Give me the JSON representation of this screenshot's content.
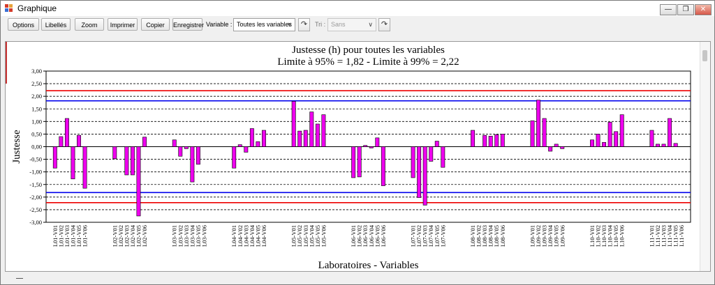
{
  "window": {
    "title": "Graphique",
    "minimize_icon": "minimize-icon",
    "restore_icon": "restore-icon",
    "close_icon": "close-icon"
  },
  "toolbar": {
    "options_label": "Options",
    "labels_label": "Libellés",
    "zoom_label": "Zoom",
    "print_label": "Imprimer",
    "copy_label": "Copier",
    "save_label": "Enregistrer",
    "variable_label": "Variable :",
    "variable_value": "Toutes les variables",
    "sort_label": "Tri :",
    "sort_value": "Sans"
  },
  "chart_data": {
    "type": "bar",
    "title": "Justesse (h) pour toutes les variables",
    "subtitle": "Limite à 95% = 1,82 - Limite à 99% = 2,22",
    "xlabel": "Laboratoires - Variables",
    "ylabel": "Justesse",
    "ylim": [
      -3,
      3
    ],
    "ytick_labels": [
      "3,00",
      "2,50",
      "2,00",
      "1,50",
      "1,00",
      "0,50",
      "0,00",
      "-0,50",
      "-1,00",
      "-1,50",
      "-2,00",
      "-2,50",
      "-3,00"
    ],
    "grid": "horizontal dashed",
    "bar_color": "#ee00ee",
    "limit_lines": [
      {
        "value": 2.22,
        "color": "#ee0000"
      },
      {
        "value": 1.82,
        "color": "#0000ee"
      },
      {
        "value": -1.82,
        "color": "#0000ee"
      },
      {
        "value": -2.22,
        "color": "#ee0000"
      }
    ],
    "groups": [
      {
        "categories": [
          "L01-V01",
          "L01-V02",
          "L01-V03",
          "L01-V04",
          "L01-V05",
          "L01-V06"
        ],
        "values": [
          -0.85,
          0.4,
          1.12,
          -1.28,
          0.45,
          -1.65
        ]
      },
      {
        "categories": [
          "L02-V01",
          "L02-V02",
          "L02-V03",
          "L02-V04",
          "L02-V05",
          "L02-V06"
        ],
        "values": [
          -0.48,
          0.0,
          -1.12,
          -1.12,
          -2.75,
          0.38
        ]
      },
      {
        "categories": [
          "L03-V01",
          "L03-V02",
          "L03-V03",
          "L03-V04",
          "L03-V05",
          "L03-V06"
        ],
        "values": [
          0.27,
          -0.38,
          -0.08,
          -1.4,
          -0.7,
          0.0
        ]
      },
      {
        "categories": [
          "L04-V01",
          "L04-V02",
          "L04-V03",
          "L04-V04",
          "L04-V05",
          "L04-V06"
        ],
        "values": [
          -0.85,
          0.08,
          -0.22,
          0.72,
          0.2,
          0.65
        ]
      },
      {
        "categories": [
          "L05-V01",
          "L05-V02",
          "L05-V03",
          "L05-V04",
          "L05-V05",
          "L05-V06"
        ],
        "values": [
          1.8,
          0.62,
          0.65,
          1.38,
          0.9,
          1.27
        ]
      },
      {
        "categories": [
          "L06-V01",
          "L06-V02",
          "L06-V03",
          "L06-V04",
          "L06-V05",
          "L06-V06"
        ],
        "values": [
          -1.23,
          -1.2,
          0.05,
          -0.05,
          0.35,
          -1.55
        ]
      },
      {
        "categories": [
          "L07-V01",
          "L07-V02",
          "L07-V03",
          "L07-V04",
          "L07-V05",
          "L07-V06"
        ],
        "values": [
          -1.23,
          -2.02,
          -2.32,
          -0.58,
          0.22,
          -0.82
        ]
      },
      {
        "categories": [
          "L08-V01",
          "L08-V02",
          "L08-V03",
          "L08-V04",
          "L08-V05",
          "L08-V06"
        ],
        "values": [
          0.65,
          0.0,
          0.45,
          0.42,
          0.48,
          0.5
        ]
      },
      {
        "categories": [
          "L09-V01",
          "L09-V02",
          "L09-V03",
          "L09-V04",
          "L09-V05",
          "L09-V06"
        ],
        "values": [
          1.03,
          1.85,
          1.12,
          -0.18,
          0.1,
          -0.08
        ]
      },
      {
        "categories": [
          "L10-V01",
          "L10-V02",
          "L10-V03",
          "L10-V04",
          "L10-V05",
          "L10-V06"
        ],
        "values": [
          0.27,
          0.5,
          0.17,
          0.97,
          0.6,
          1.27
        ]
      },
      {
        "categories": [
          "L11-V01",
          "L11-V02",
          "L11-V03",
          "L11-V04",
          "L11-V05",
          "L11-V06"
        ],
        "values": [
          0.65,
          0.1,
          0.1,
          1.12,
          0.13,
          0.0
        ]
      }
    ]
  }
}
